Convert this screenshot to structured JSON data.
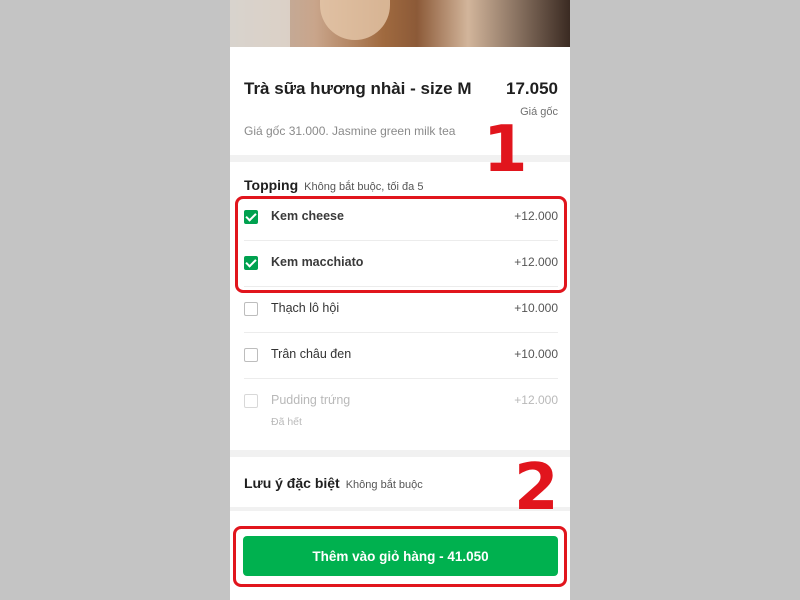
{
  "product": {
    "name": "Trà sữa hương nhài - size M",
    "price": "17.050",
    "price_note": "Giá gốc",
    "description": "Giá gốc 31.000. Jasmine green milk tea"
  },
  "topping": {
    "title": "Topping",
    "subtitle": "Không bắt buộc, tối đa 5",
    "options": [
      {
        "label": "Kem cheese",
        "price": "+12.000",
        "checked": true
      },
      {
        "label": "Kem macchiato",
        "price": "+12.000",
        "checked": true
      },
      {
        "label": "Thạch lô hội",
        "price": "+10.000",
        "checked": false
      },
      {
        "label": "Trân châu đen",
        "price": "+10.000",
        "checked": false
      },
      {
        "label": "Pudding trứng",
        "price": "+12.000",
        "checked": false,
        "disabled": true,
        "status": "Đã hết"
      }
    ]
  },
  "note": {
    "title": "Lưu ý đặc biệt",
    "subtitle": "Không bắt buộc"
  },
  "cta": {
    "label": "Thêm vào giỏ hàng - 41.050"
  },
  "annotations": {
    "marker_1": "1",
    "marker_2": "2"
  },
  "colors": {
    "accent": "#00b14f",
    "annotation": "#e1151d"
  }
}
